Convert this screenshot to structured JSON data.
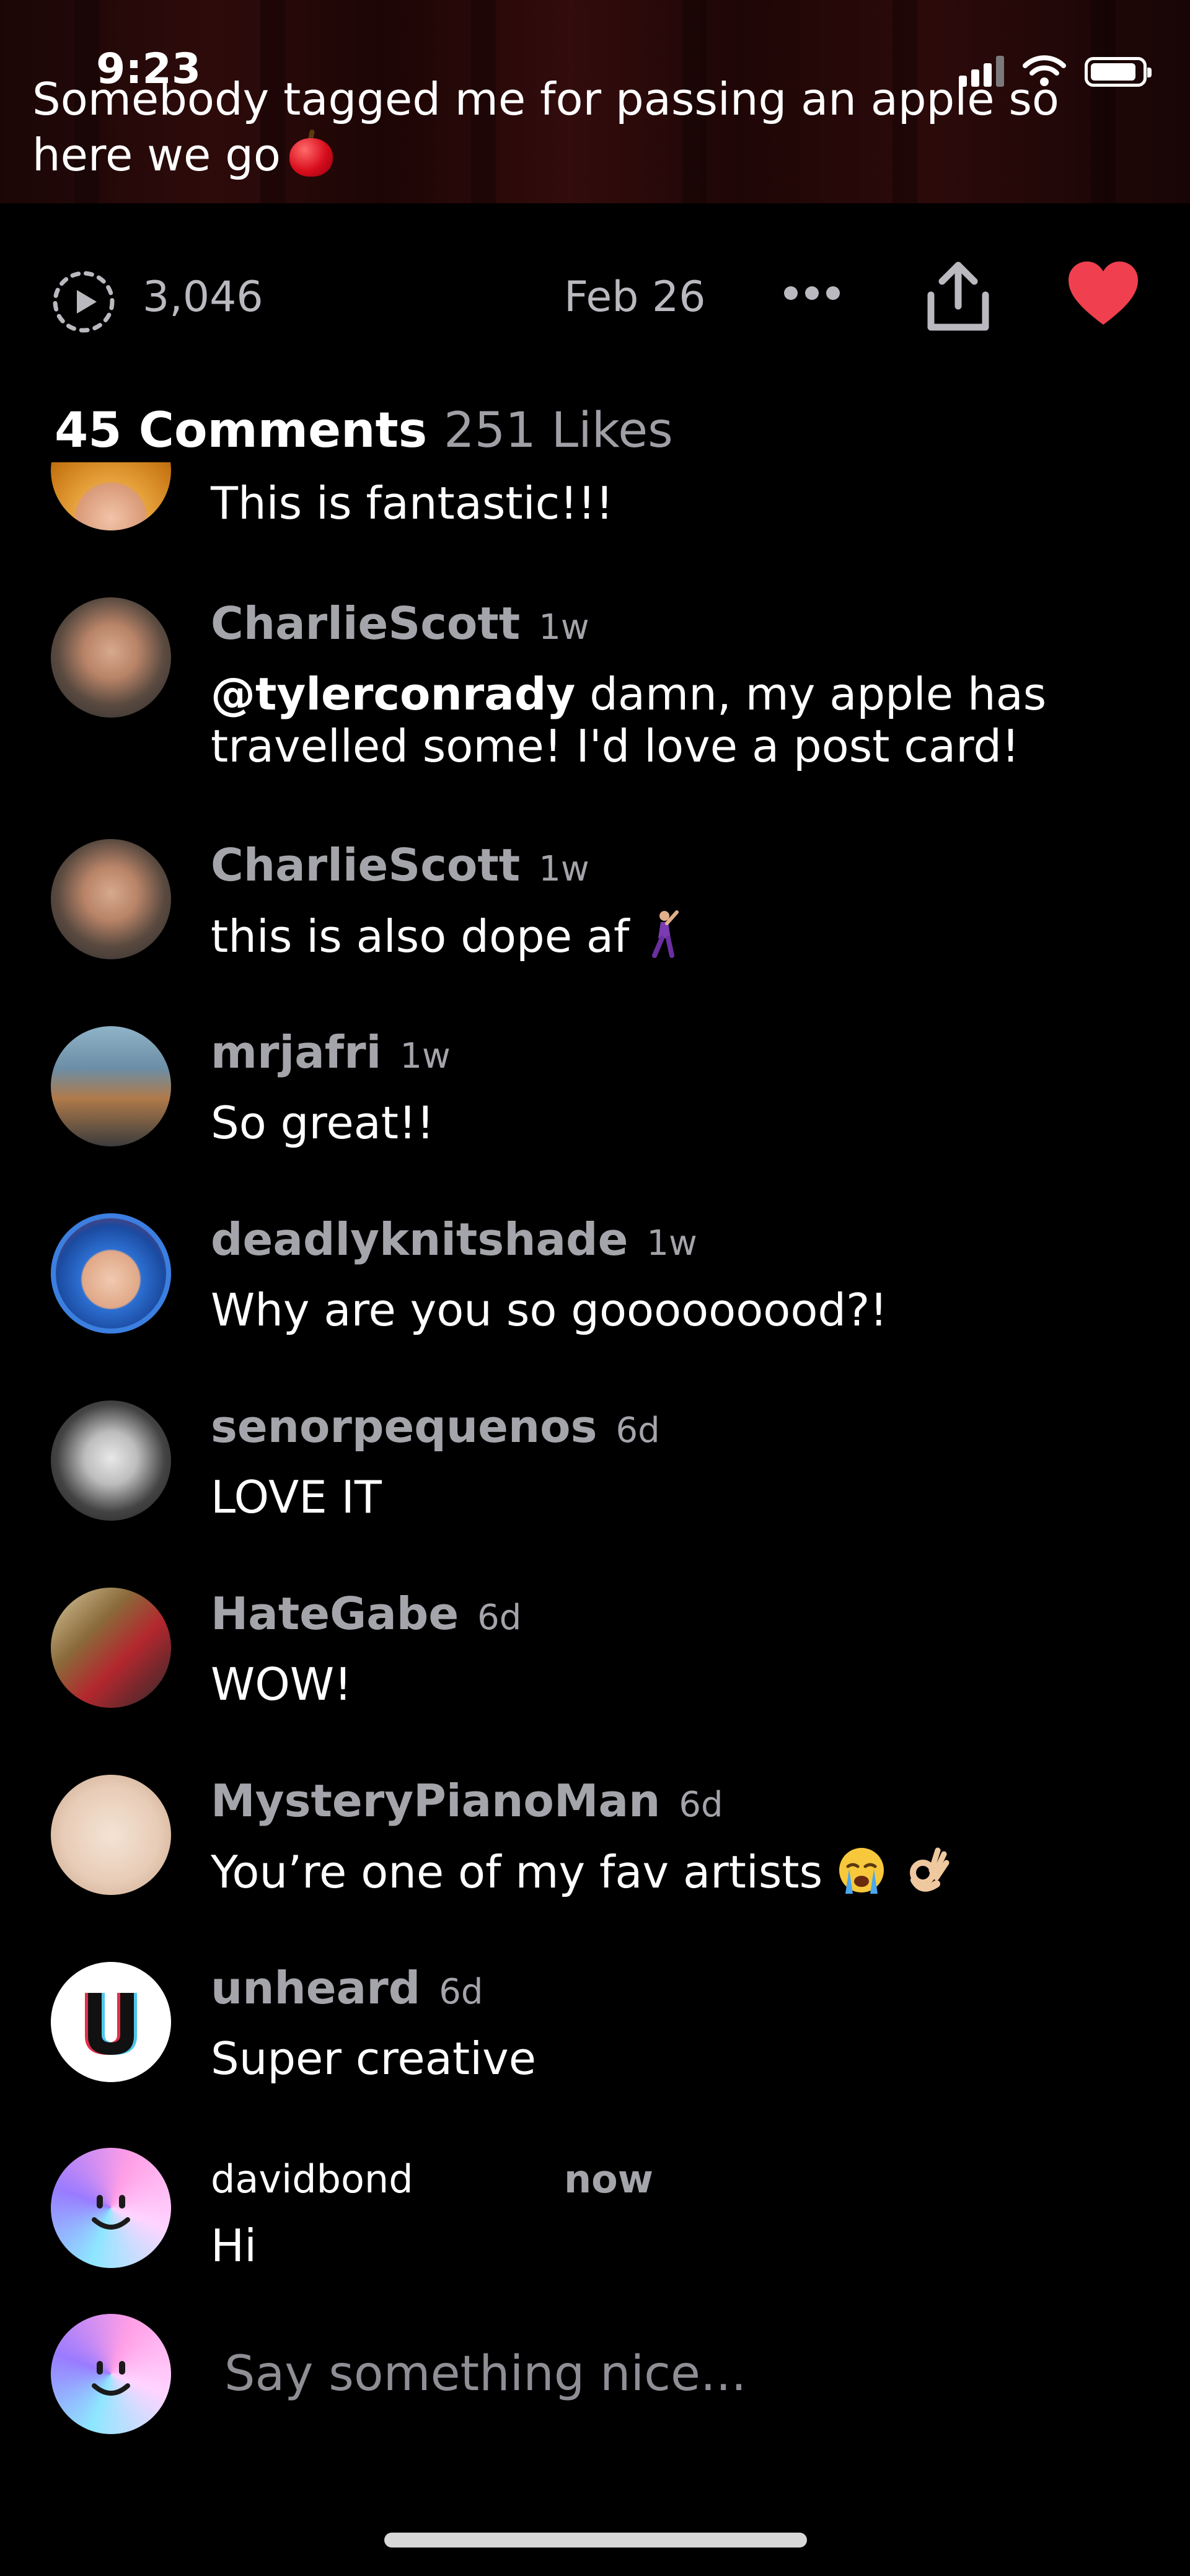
{
  "status_bar": {
    "time": "9:23"
  },
  "post": {
    "caption": "Somebody tagged me for passing an apple so here we go",
    "caption_emoji": "apple-emoji",
    "plays": "3,046",
    "date": "Feb 26",
    "liked": true
  },
  "tabs": {
    "comments": "45 Comments",
    "likes": "251 Likes"
  },
  "comments": {
    "partial_text": "This is fantastic!!!",
    "items": [
      {
        "user": "CharlieScott",
        "time": "1w",
        "mention": "@tylerconrady",
        "text": " damn, my apple has",
        "text2": "travelled some!  I'd love a post card!"
      },
      {
        "user": "CharlieScott",
        "time": "1w",
        "text": "this is also dope af",
        "emoji": "dancing-man-emoji"
      },
      {
        "user": "mrjafri",
        "time": "1w",
        "text": "So great!!"
      },
      {
        "user": "deadlyknitshade",
        "time": "1w",
        "text": "Why are you so gooooooood?!"
      },
      {
        "user": "senorpequenos",
        "time": "6d",
        "text": "LOVE IT"
      },
      {
        "user": "HateGabe",
        "time": "6d",
        "text": "WOW!"
      },
      {
        "user": "MysteryPianoMan",
        "time": "6d",
        "text": "You’re one of my fav artists",
        "emoji": "crying-face-emoji ok-hand-emoji"
      },
      {
        "user": "unheard",
        "time": "6d",
        "text": "Super creative"
      }
    ],
    "new_comment": {
      "user": "davidbond",
      "time": "now",
      "text": "Hi"
    }
  },
  "input": {
    "placeholder": "Say something nice..."
  },
  "colors": {
    "background": "#000000",
    "heart": "#f0404f",
    "muted": "#a4a4ab"
  }
}
